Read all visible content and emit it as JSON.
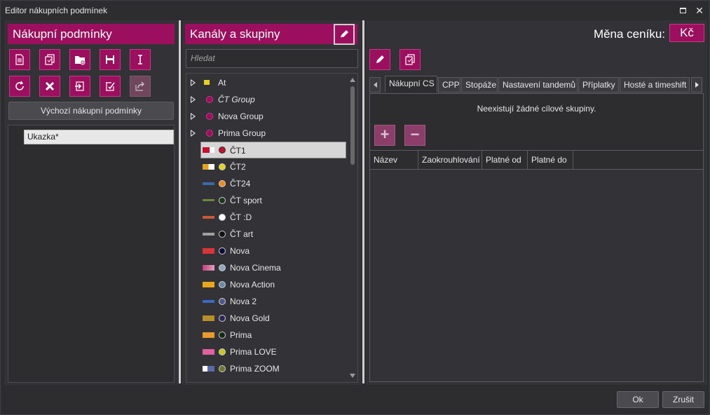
{
  "window": {
    "title": "Editor nákupních podmínek"
  },
  "left": {
    "header": "Nákupní podmínky",
    "toolbar_row1": [
      "new-document-icon",
      "copy-icon",
      "open-folder-icon",
      "save-icon",
      "rename-icon"
    ],
    "toolbar_row2": [
      "refresh-icon",
      "delete-icon",
      "import-icon",
      "edit-check-icon",
      "export-icon"
    ],
    "default_button": "Výchozí nákupní podmínky",
    "items": [
      {
        "label": "Ukazka*"
      }
    ]
  },
  "middle": {
    "header": "Kanály a skupiny",
    "search_placeholder": "Hledat",
    "groups": [
      {
        "label": "At",
        "italic": false
      },
      {
        "label": "ČT Group",
        "italic": true,
        "color": "#9c0f5f"
      },
      {
        "label": "Nova Group",
        "italic": false,
        "color": "#9c0f5f"
      },
      {
        "label": "Prima Group",
        "italic": false,
        "color": "#9c0f5f"
      }
    ],
    "channels": [
      {
        "label": "ČT1",
        "color": "#c8102e",
        "selected": true
      },
      {
        "label": "ČT2",
        "color": "#e2d21a"
      },
      {
        "label": "ČT24",
        "color": "#f08a1c"
      },
      {
        "label": "ČT sport",
        "color": "#1a3a1a"
      },
      {
        "label": "ČT :D",
        "color": "#ffffff"
      },
      {
        "label": "ČT art",
        "color": "#111111"
      },
      {
        "label": "Nova",
        "color": "#0b0b3a"
      },
      {
        "label": "Nova Cinema",
        "color": "#8fa8c0"
      },
      {
        "label": "Nova Action",
        "color": "#6f8aa8"
      },
      {
        "label": "Nova 2",
        "color": "#4a5a8a"
      },
      {
        "label": "Nova Gold",
        "color": "#2a2a5a"
      },
      {
        "label": "Prima",
        "color": "#0f2a0f"
      },
      {
        "label": "Prima LOVE",
        "color": "#c8c81a"
      },
      {
        "label": "Prima ZOOM",
        "color": "#6a7a2a"
      }
    ]
  },
  "right": {
    "currency_label": "Měna ceníku:",
    "currency_value": "Kč",
    "tabs": [
      "Nákupní CS",
      "CPP",
      "Stopáže",
      "Nastavení tandemů",
      "Příplatky",
      "Hosté a timeshift"
    ],
    "active_tab": "Nákupní CS",
    "empty_message": "Neexistují žádné cílové skupiny.",
    "add_symbol": "+",
    "remove_symbol": "−",
    "columns": [
      "Název",
      "Zaokrouhlování",
      "Platné od",
      "Platné do"
    ]
  },
  "footer": {
    "ok": "Ok",
    "cancel": "Zrušit"
  },
  "colors": {
    "accent": "#9c0f5f",
    "background": "#2d2d30",
    "panel": "#333337"
  }
}
